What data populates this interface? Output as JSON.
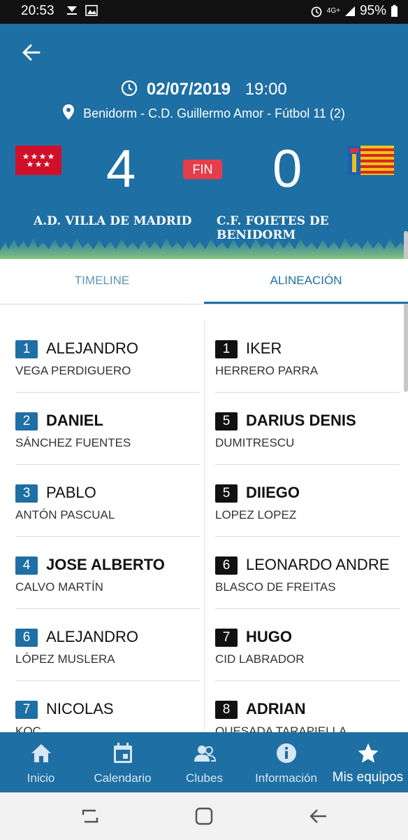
{
  "status_bar": {
    "time": "20:53",
    "network": "4G+",
    "battery": "95%"
  },
  "match": {
    "date": "02/07/2019",
    "time": "19:00",
    "venue": "Benidorm - C.D. Guillermo Amor - Fútbol 11 (2)",
    "home_team": "A.D. VILLA DE MADRID",
    "away_team": "C.F. FOIETES DE BENIDORM",
    "home_score": "4",
    "away_score": "0",
    "status": "FIN"
  },
  "tabs": [
    {
      "label": "TIMELINE",
      "active": false
    },
    {
      "label": "ALINEACIÓN",
      "active": true
    }
  ],
  "lineup": {
    "home": [
      {
        "number": "1",
        "first": "ALEJANDRO",
        "last": "VEGA PERDIGUERO"
      },
      {
        "number": "2",
        "first": "DANIEL",
        "last": "SÁNCHEZ FUENTES"
      },
      {
        "number": "3",
        "first": "PABLO",
        "last": "ANTÓN PASCUAL"
      },
      {
        "number": "4",
        "first": "JOSE ALBERTO",
        "last": "CALVO MARTÍN"
      },
      {
        "number": "6",
        "first": "ALEJANDRO",
        "last": "LÓPEZ MUSLERA"
      },
      {
        "number": "7",
        "first": "NICOLAS",
        "last": "KOC"
      }
    ],
    "away": [
      {
        "number": "1",
        "first": "IKER",
        "last": "HERRERO PARRA"
      },
      {
        "number": "5",
        "first": "DARIUS DENIS",
        "last": "DUMITRESCU"
      },
      {
        "number": "5",
        "first": "DIIEGO",
        "last": "LOPEZ LOPEZ"
      },
      {
        "number": "6",
        "first": "LEONARDO ANDRE",
        "last": "BLASCO DE FREITAS"
      },
      {
        "number": "7",
        "first": "HUGO",
        "last": "CID LABRADOR"
      },
      {
        "number": "8",
        "first": "ADRIAN",
        "last": "QUESADA TARAPIELLA"
      }
    ]
  },
  "bottom_nav": [
    {
      "label": "Inicio",
      "icon": "home-icon"
    },
    {
      "label": "Calendario",
      "icon": "calendar-icon"
    },
    {
      "label": "Clubes",
      "icon": "clubs-icon"
    },
    {
      "label": "Información",
      "icon": "info-icon"
    },
    {
      "label": "Mis equipos",
      "icon": "star-icon",
      "active": true
    }
  ],
  "colors": {
    "primary": "#1e6fa3",
    "status_badge": "#e63d4a",
    "home_number": "#1e6fa3",
    "away_number": "#111111"
  }
}
